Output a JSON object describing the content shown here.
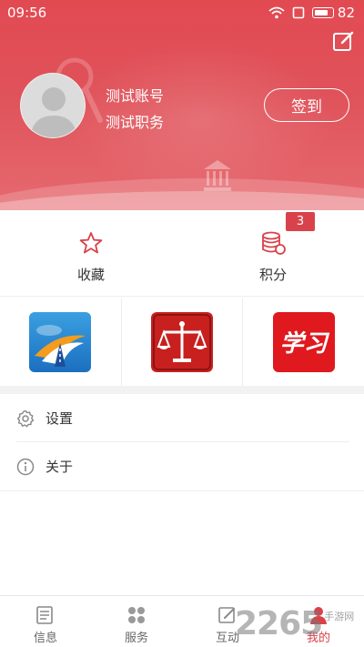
{
  "status": {
    "time": "09:56",
    "battery": "82",
    "battery_level": 0.82
  },
  "profile": {
    "name": "测试账号",
    "role": "测试职务",
    "checkin_label": "签到"
  },
  "quick": [
    {
      "label": "收藏",
      "icon": "star-icon"
    },
    {
      "label": "积分",
      "icon": "coins-icon",
      "badge": "3"
    }
  ],
  "apps": [
    {
      "icon": "highway-app-icon"
    },
    {
      "icon": "justice-scale-app-icon"
    },
    {
      "icon": "study-app-icon",
      "text": "学习"
    }
  ],
  "menu": [
    {
      "label": "设置",
      "icon": "gear-icon"
    },
    {
      "label": "关于",
      "icon": "info-icon"
    }
  ],
  "tabs": [
    {
      "label": "信息",
      "icon": "news-icon"
    },
    {
      "label": "服务",
      "icon": "grid-icon"
    },
    {
      "label": "互动",
      "icon": "interact-icon"
    },
    {
      "label": "我的",
      "icon": "user-icon",
      "active": true
    }
  ],
  "watermark": {
    "big": "2265",
    "small": "手游网"
  },
  "colors": {
    "brand": "#e0525a",
    "accent": "#d9424a"
  }
}
